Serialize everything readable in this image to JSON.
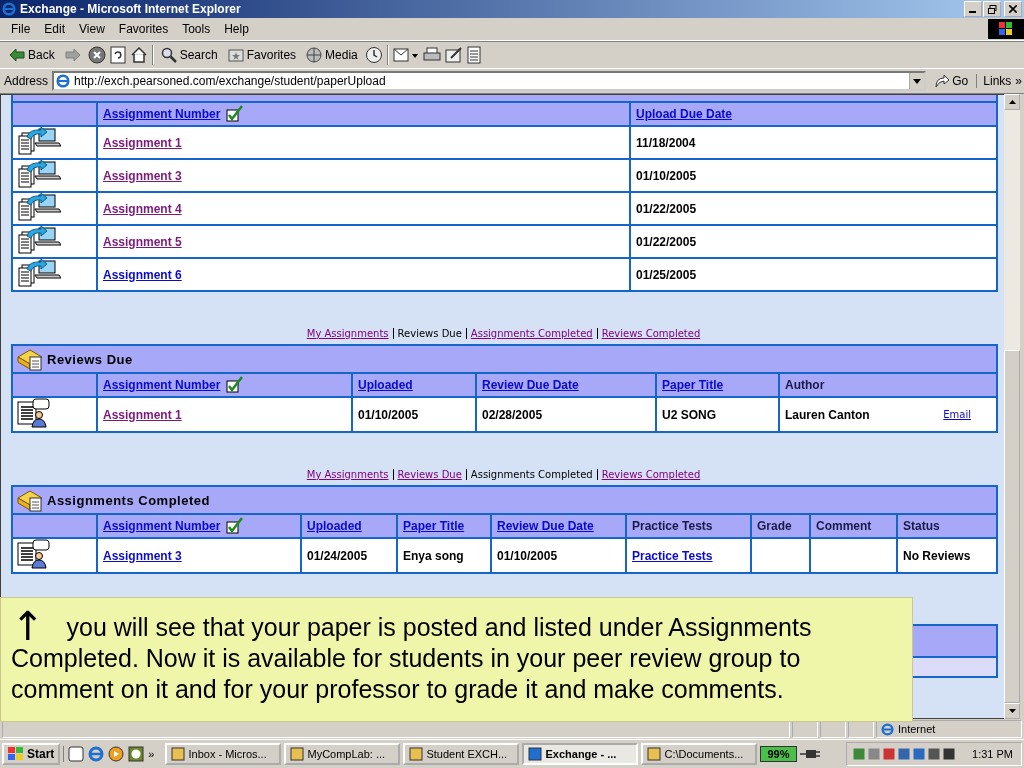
{
  "window": {
    "title": "Exchange - Microsoft Internet Explorer"
  },
  "menu": [
    "File",
    "Edit",
    "View",
    "Favorites",
    "Tools",
    "Help"
  ],
  "toolbar": [
    {
      "kind": "back",
      "label": "Back"
    },
    {
      "kind": "forward"
    },
    {
      "kind": "stop"
    },
    {
      "kind": "refresh"
    },
    {
      "kind": "home"
    },
    {
      "kind": "search",
      "label": "Search"
    },
    {
      "kind": "favorites",
      "label": "Favorites"
    },
    {
      "kind": "media",
      "label": "Media"
    },
    {
      "kind": "history"
    },
    {
      "kind": "mail"
    },
    {
      "kind": "print"
    },
    {
      "kind": "edit"
    },
    {
      "kind": "discuss"
    }
  ],
  "address": {
    "label": "Address",
    "value": "http://exch.pearsoned.com/exchange/student/paperUpload",
    "go": "Go",
    "links": "Links",
    "more": "»"
  },
  "sections": [
    {
      "kind": "upload",
      "columns": [
        {
          "label": "Assignment Number",
          "link": true,
          "sorted": true
        },
        {
          "label": "Upload Due Date",
          "link": true,
          "sorted": false
        }
      ],
      "rows": [
        {
          "cells": [
            {
              "text": "Assignment 1",
              "kind": "visited"
            },
            {
              "text": "11/18/2004",
              "kind": "text"
            }
          ]
        },
        {
          "cells": [
            {
              "text": "Assignment 3",
              "kind": "visited"
            },
            {
              "text": "01/10/2005",
              "kind": "text"
            }
          ]
        },
        {
          "cells": [
            {
              "text": "Assignment 4",
              "kind": "visited"
            },
            {
              "text": "01/22/2005",
              "kind": "text"
            }
          ]
        },
        {
          "cells": [
            {
              "text": "Assignment 5",
              "kind": "visited"
            },
            {
              "text": "01/22/2005",
              "kind": "text"
            }
          ]
        },
        {
          "cells": [
            {
              "text": "Assignment 6",
              "kind": "link"
            },
            {
              "text": "01/25/2005",
              "kind": "text"
            }
          ]
        }
      ]
    },
    {
      "kind": "reviews",
      "title": "Reviews Due",
      "nav": [
        {
          "label": "My Assignments",
          "selected": false
        },
        {
          "label": "Reviews Due",
          "selected": true
        },
        {
          "label": "Assignments Completed",
          "selected": false
        },
        {
          "label": "Reviews Completed",
          "selected": false
        }
      ],
      "columns": [
        {
          "label": "Assignment Number",
          "link": true,
          "sorted": true
        },
        {
          "label": "Uploaded",
          "link": true,
          "sorted": false
        },
        {
          "label": "Review Due Date",
          "link": true,
          "sorted": false
        },
        {
          "label": "Paper Title",
          "link": true,
          "sorted": false
        },
        {
          "label": "Author",
          "link": false,
          "sorted": false
        }
      ],
      "rows": [
        {
          "cells": [
            {
              "text": "Assignment 1",
              "kind": "visited"
            },
            {
              "text": "01/10/2005",
              "kind": "text"
            },
            {
              "text": "02/28/2005",
              "kind": "text"
            },
            {
              "text": "U2 SONG",
              "kind": "text"
            },
            {
              "text": "Lauren Canton",
              "kind": "text",
              "action": "Email"
            }
          ]
        }
      ]
    },
    {
      "kind": "completed",
      "title": "Assignments Completed",
      "nav": [
        {
          "label": "My Assignments",
          "selected": false
        },
        {
          "label": "Reviews Due",
          "selected": false
        },
        {
          "label": "Assignments Completed",
          "selected": true
        },
        {
          "label": "Reviews Completed",
          "selected": false
        }
      ],
      "columns": [
        {
          "label": "Assignment Number",
          "link": true,
          "sorted": true
        },
        {
          "label": "Uploaded",
          "link": true,
          "sorted": false
        },
        {
          "label": "Paper Title",
          "link": true,
          "sorted": false
        },
        {
          "label": "Review Due Date",
          "link": true,
          "sorted": false
        },
        {
          "label": "Practice Tests",
          "link": false,
          "sorted": false
        },
        {
          "label": "Grade",
          "link": false,
          "sorted": false
        },
        {
          "label": "Comment",
          "link": false,
          "sorted": false
        },
        {
          "label": "Status",
          "link": false,
          "sorted": false
        }
      ],
      "rows": [
        {
          "cells": [
            {
              "text": "Assignment 3",
              "kind": "link"
            },
            {
              "text": "01/24/2005",
              "kind": "text"
            },
            {
              "text": "Enya song",
              "kind": "text"
            },
            {
              "text": "01/10/2005",
              "kind": "text"
            },
            {
              "text": "Practice Tests",
              "kind": "link"
            },
            {
              "text": "",
              "kind": "empty"
            },
            {
              "text": "",
              "kind": "empty"
            },
            {
              "text": "No Reviews",
              "kind": "text"
            }
          ]
        }
      ]
    }
  ],
  "status_bar": {
    "zone": "Internet"
  },
  "taskbar": {
    "start": "Start",
    "more": "»",
    "tasks": [
      {
        "label": "Inbox - Micros...",
        "selected": false
      },
      {
        "label": "MyCompLab: ...",
        "selected": false
      },
      {
        "label": "Student EXCH...",
        "selected": false
      },
      {
        "label": "Exchange - ...",
        "selected": true
      },
      {
        "label": "C:\\Documents...",
        "selected": false
      }
    ],
    "battery": "99%",
    "clock": "1:31 PM"
  },
  "callout": {
    "arrow": "↑",
    "text": "you will see that your paper is posted and listed under Assignments Completed. Now it is available for students in your peer review group to comment on it and for your professor to grade it and make comments."
  }
}
